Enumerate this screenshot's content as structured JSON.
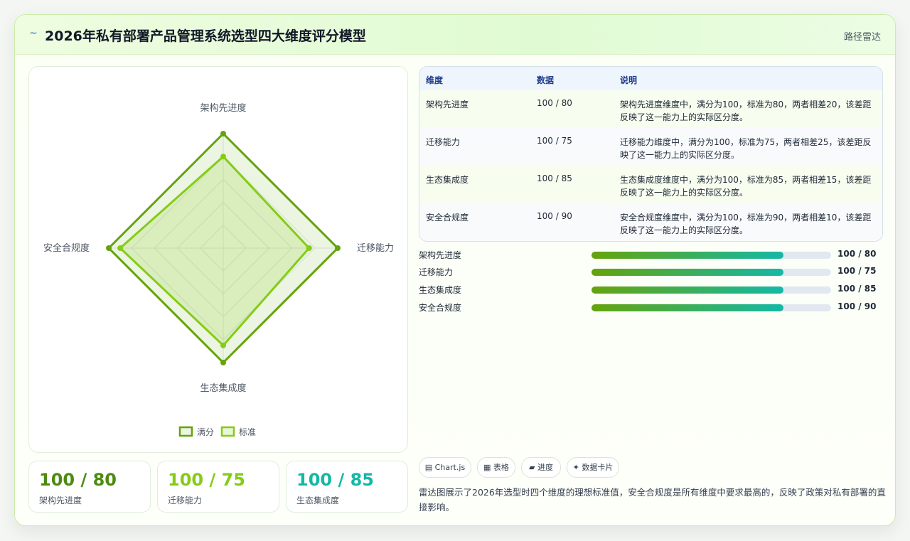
{
  "header": {
    "logo_icon": "~",
    "title": "2026年私有部署产品管理系统选型四大维度评分模型",
    "tag": "路径雷达"
  },
  "chart_data": {
    "type": "radar",
    "axes": [
      "架构先进度",
      "迁移能力",
      "生态集成度",
      "安全合规度"
    ],
    "range": [
      0,
      100
    ],
    "series": [
      {
        "name": "满分",
        "values": [
          100,
          100,
          100,
          100
        ],
        "color": "#65a30d"
      },
      {
        "name": "标准",
        "values": [
          80,
          75,
          85,
          90
        ],
        "color": "#84cc16"
      }
    ],
    "legend": "bottom"
  },
  "kpis": [
    {
      "value": "100 / 80",
      "label": "架构先进度",
      "color": "#4d8a12"
    },
    {
      "value": "100 / 75",
      "label": "迁移能力",
      "color": "#84cc16"
    },
    {
      "value": "100 / 85",
      "label": "生态集成度",
      "color": "#14b8a6"
    }
  ],
  "table": {
    "headers": [
      "维度",
      "数据",
      "说明"
    ],
    "rows": [
      {
        "dim": "架构先进度",
        "data": "100 / 80",
        "desc": "架构先进度维度中，满分为100，标准为80，两者相差20，该差距反映了这一能力上的实际区分度。"
      },
      {
        "dim": "迁移能力",
        "data": "100 / 75",
        "desc": "迁移能力维度中，满分为100，标准为75，两者相差25，该差距反映了这一能力上的实际区分度。"
      },
      {
        "dim": "生态集成度",
        "data": "100 / 85",
        "desc": "生态集成度维度中，满分为100，标准为85，两者相差15，该差距反映了这一能力上的实际区分度。"
      },
      {
        "dim": "安全合规度",
        "data": "100 / 90",
        "desc": "安全合规度维度中，满分为100，标准为90，两者相差10，该差距反映了这一能力上的实际区分度。"
      }
    ]
  },
  "progress": [
    {
      "name": "架构先进度",
      "value": "100 / 80",
      "fill": 0.8
    },
    {
      "name": "迁移能力",
      "value": "100 / 75",
      "fill": 0.8
    },
    {
      "name": "生态集成度",
      "value": "100 / 85",
      "fill": 0.8
    },
    {
      "name": "安全合规度",
      "value": "100 / 90",
      "fill": 0.8
    }
  ],
  "chips": [
    "▤ Chart.js",
    "▦ 表格",
    "▰ 进度",
    "✦ 数据卡片"
  ],
  "note": "雷达图展示了2026年选型时四个维度的理想标准值，安全合规度是所有维度中要求最高的，反映了政策对私有部署的直接影响。"
}
